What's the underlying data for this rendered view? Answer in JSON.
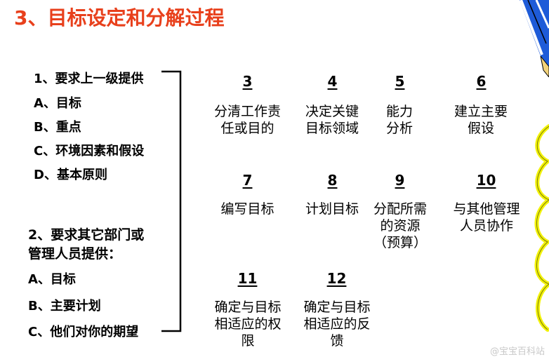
{
  "title": "3、目标设定和分解过程",
  "left_group1": {
    "heading": "1、要求上一级提供",
    "items": [
      "A、目标",
      "B、重点",
      "C、环境因素和假设",
      "D、基本原则"
    ]
  },
  "left_group2": {
    "heading_line1": "2、要求其它部门或",
    "heading_line2": "管理人员提供：",
    "items": [
      "A、目标",
      "B、主要计划",
      "C、他们对你的期望"
    ]
  },
  "steps": [
    {
      "num": "3",
      "text": "分清工作责\n任或目的"
    },
    {
      "num": "4",
      "text": "决定关键\n目标领域"
    },
    {
      "num": "5",
      "text": "能力\n分析"
    },
    {
      "num": "6",
      "text": "建立主要\n假设"
    },
    {
      "num": "7",
      "text": "编写目标"
    },
    {
      "num": "8",
      "text": "计划目标"
    },
    {
      "num": "9",
      "text": "分配所需\n的资源\n（预算）"
    },
    {
      "num": "10",
      "text": "与其他管理\n人员协作"
    },
    {
      "num": "11",
      "text": "确定与目标\n相适应的权\n限"
    },
    {
      "num": "12",
      "text": "确定与目标\n相适应的反\n馈"
    }
  ],
  "watermark": "@宝宝百科站",
  "colors": {
    "title": "#e8401c",
    "decor_blue": "#1e5bd8",
    "decor_yellow": "#f2f20a"
  }
}
